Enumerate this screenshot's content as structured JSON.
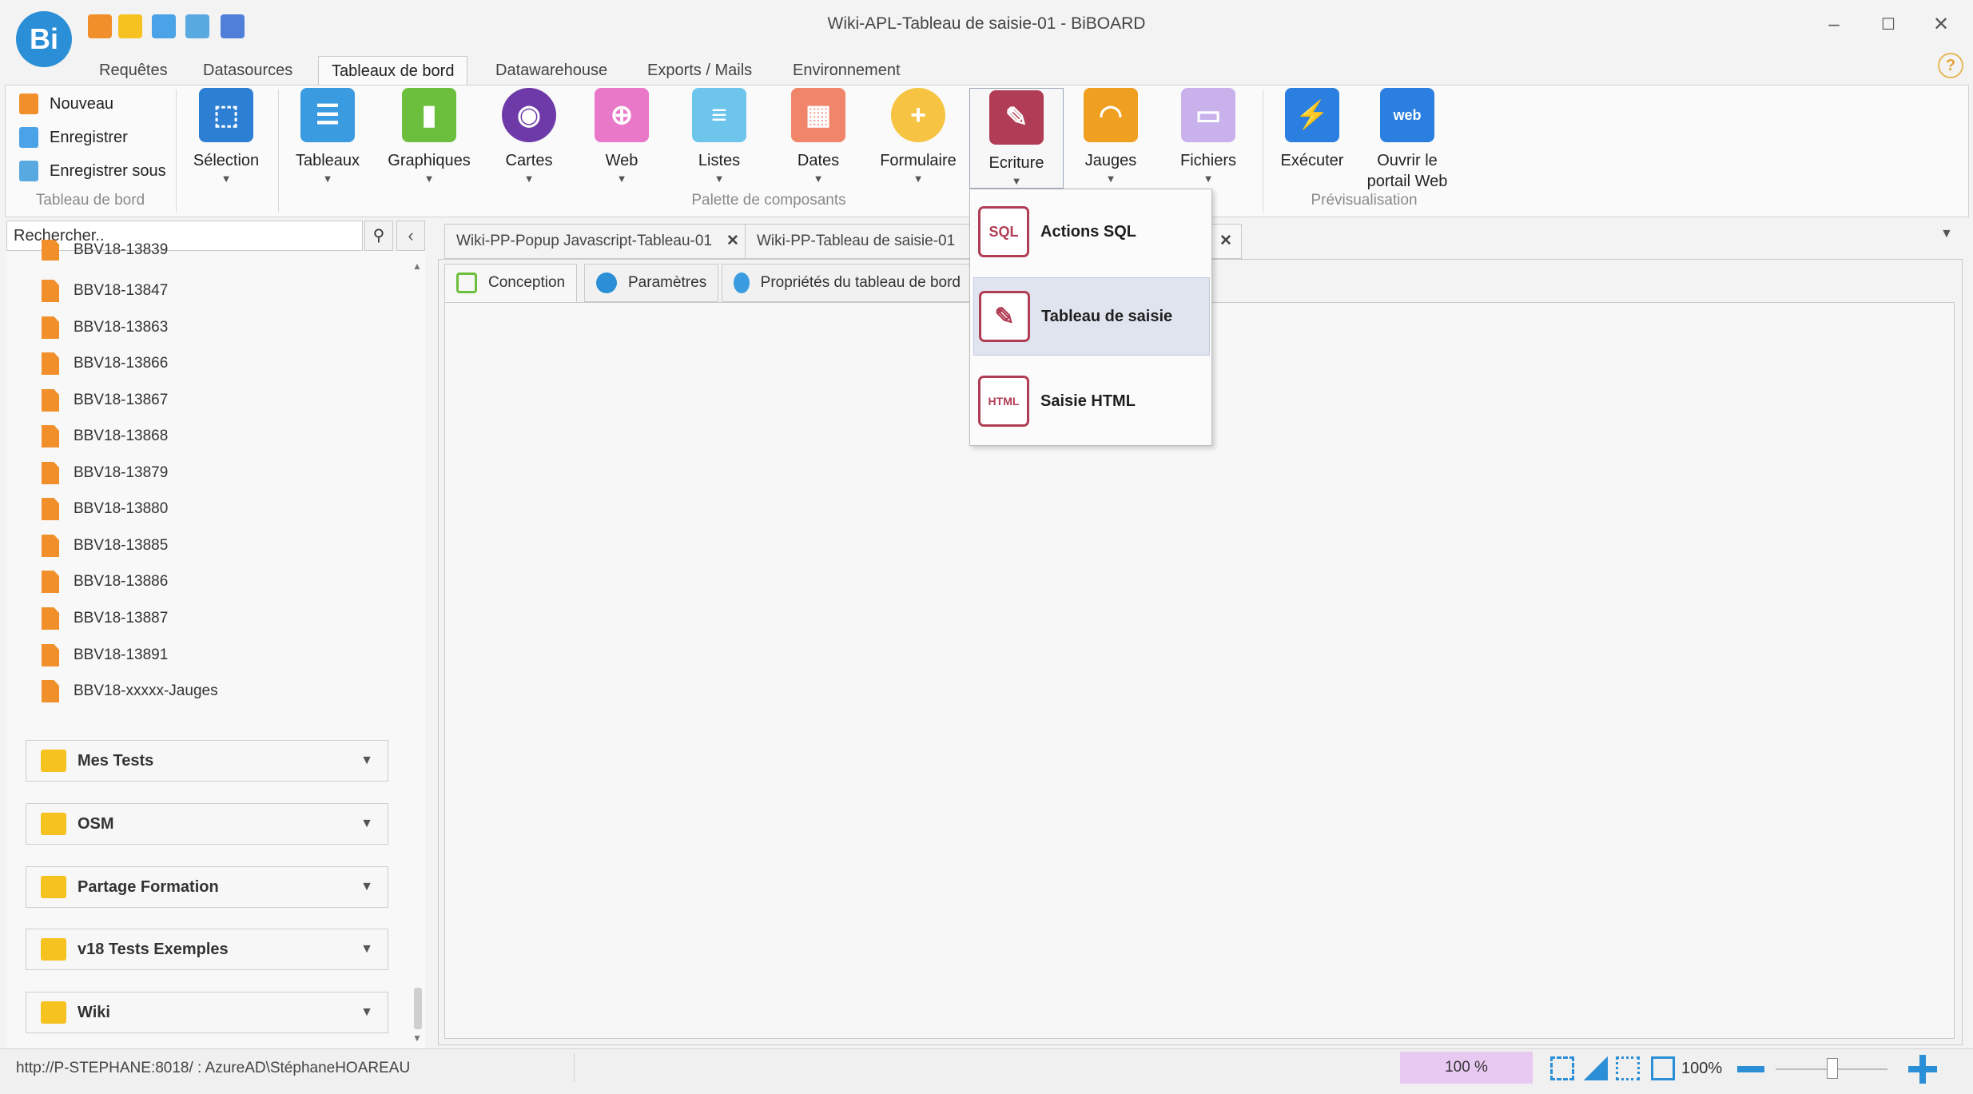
{
  "window": {
    "title": "Wiki-APL-Tableau de saisie-01 - BiBOARD",
    "logo_text": "Bi",
    "quick_access": [
      "new-file-icon",
      "new-folder-icon",
      "save-icon",
      "edit-icon",
      "window-icon"
    ],
    "controls": {
      "minimize": "–",
      "maximize": "☐",
      "close": "✕"
    }
  },
  "menu_tabs": [
    "Requêtes",
    "Datasources",
    "Tableaux de bord",
    "Datawarehouse",
    "Exports / Mails",
    "Environnement"
  ],
  "active_menu_tab": "Tableaux de bord",
  "help": "?",
  "ribbon": {
    "dashboard_group": {
      "label": "Tableau de bord",
      "commands": [
        "Nouveau",
        "Enregistrer",
        "Enregistrer sous"
      ]
    },
    "selection": "Sélection",
    "palette_group": {
      "label": "Palette de composants",
      "items": [
        "Tableaux",
        "Graphiques",
        "Cartes",
        "Web",
        "Listes",
        "Dates",
        "Formulaire",
        "Ecriture",
        "Jauges",
        "Fichiers"
      ]
    },
    "preview_group": {
      "label": "Prévisualisation",
      "items": [
        "Exécuter",
        "Ouvrir le portail Web"
      ]
    },
    "colors": {
      "selection": "#2d7fd4",
      "tableaux": "#3a9be0",
      "graphiques": "#6cbf3c",
      "cartes": "#6d3aa8",
      "web": "#e978c8",
      "listes": "#6ec5ec",
      "dates": "#f0856a",
      "formulaire": "#f6c442",
      "ecriture": "#b03d55",
      "jauges": "#f0a020",
      "fichiers": "#c9b2ec",
      "executer": "#2a7fe0",
      "portail": "#2a7fe0"
    }
  },
  "search": {
    "placeholder": "Rechercher.."
  },
  "tree": {
    "items": [
      "BBV18-13839",
      "BBV18-13847",
      "BBV18-13863",
      "BBV18-13866",
      "BBV18-13867",
      "BBV18-13868",
      "BBV18-13879",
      "BBV18-13880",
      "BBV18-13885",
      "BBV18-13886",
      "BBV18-13887",
      "BBV18-13891",
      "BBV18-xxxxx-Jauges"
    ],
    "folders": [
      "Mes Tests",
      "OSM",
      "Partage Formation",
      "v18 Tests Exemples",
      "Wiki"
    ]
  },
  "doc_tabs": [
    "Wiki-PP-Popup Javascript-Tableau-01",
    "Wiki-PP-Tableau de saisie-01"
  ],
  "sub_tabs": [
    "Conception",
    "Paramètres",
    "Propriétés du tableau de bord"
  ],
  "dropdown_menu": {
    "items": [
      {
        "label": "Actions SQL",
        "icon_text": "SQL"
      },
      {
        "label": "Tableau de saisie",
        "icon_text": "✎"
      },
      {
        "label": "Saisie HTML",
        "icon_text": "HTML"
      }
    ],
    "hovered": "Tableau de saisie"
  },
  "status": {
    "connection": "http://P-STEPHANE:8018/ : AzureAD\\StéphaneHOAREAU",
    "zoom_box": "100 %",
    "zoom_pct": "100%"
  }
}
